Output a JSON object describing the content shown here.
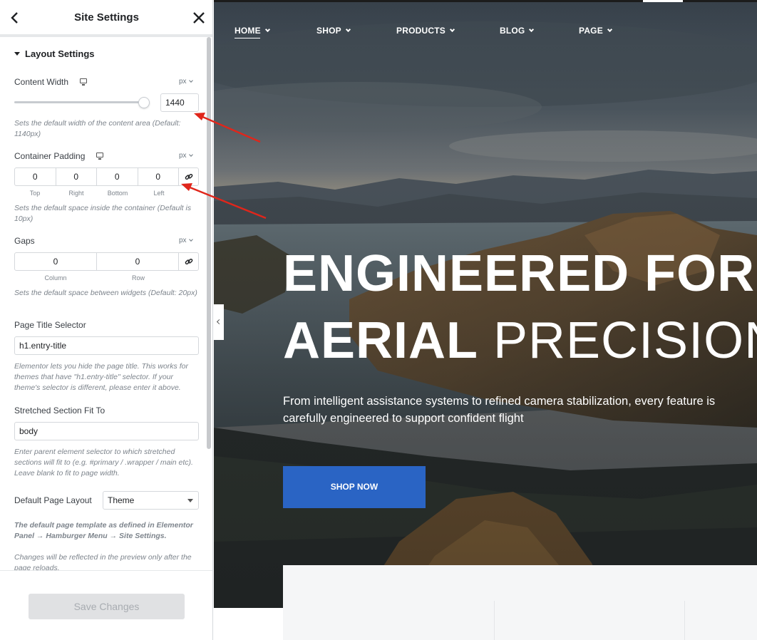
{
  "panel": {
    "title": "Site Settings",
    "section_title": "Layout Settings",
    "content_width": {
      "label": "Content Width",
      "unit": "px",
      "value": "1440",
      "slider_fraction": 1.0,
      "description": "Sets the default width of the content area (Default: 1140px)"
    },
    "container_padding": {
      "label": "Container Padding",
      "unit": "px",
      "top": "0",
      "right": "0",
      "bottom": "0",
      "left": "0",
      "labels": {
        "top": "Top",
        "right": "Right",
        "bottom": "Bottom",
        "left": "Left"
      },
      "description": "Sets the default space inside the container (Default is 10px)"
    },
    "gaps": {
      "label": "Gaps",
      "unit": "px",
      "column": "0",
      "row": "0",
      "labels": {
        "column": "Column",
        "row": "Row"
      },
      "description": "Sets the default space between widgets (Default: 20px)"
    },
    "page_title_selector": {
      "label": "Page Title Selector",
      "value": "h1.entry-title",
      "description": "Elementor lets you hide the page title. This works for themes that have \"h1.entry-title\" selector. If your theme's selector is different, please enter it above."
    },
    "stretched_section": {
      "label": "Stretched Section Fit To",
      "value": "body",
      "description": "Enter parent element selector to which stretched sections will fit to (e.g. #primary / .wrapper / main etc). Leave blank to fit to page width."
    },
    "default_page_layout": {
      "label": "Default Page Layout",
      "value": "Theme",
      "description_bold": "The default page template as defined in Elementor Panel → Hamburger Menu → Site Settings.",
      "description": "Changes will be reflected in the preview only after the page reloads."
    },
    "save_label": "Save Changes"
  },
  "preview": {
    "nav": [
      {
        "label": "HOME"
      },
      {
        "label": "SHOP"
      },
      {
        "label": "PRODUCTS"
      },
      {
        "label": "BLOG"
      },
      {
        "label": "PAGE"
      }
    ],
    "hero": {
      "line1": "ENGINEERED FOR",
      "line2_bold": "AERIAL",
      "line2_light": "PRECISION",
      "subtitle": "From intelligent assistance systems to refined camera stabilization, every feature is carefully engineered to support confident flight",
      "button": "SHOP NOW"
    }
  },
  "colors": {
    "accent": "#2a64c4",
    "annotation_arrow": "#e0261b",
    "save_disabled": "#e0e1e3"
  }
}
